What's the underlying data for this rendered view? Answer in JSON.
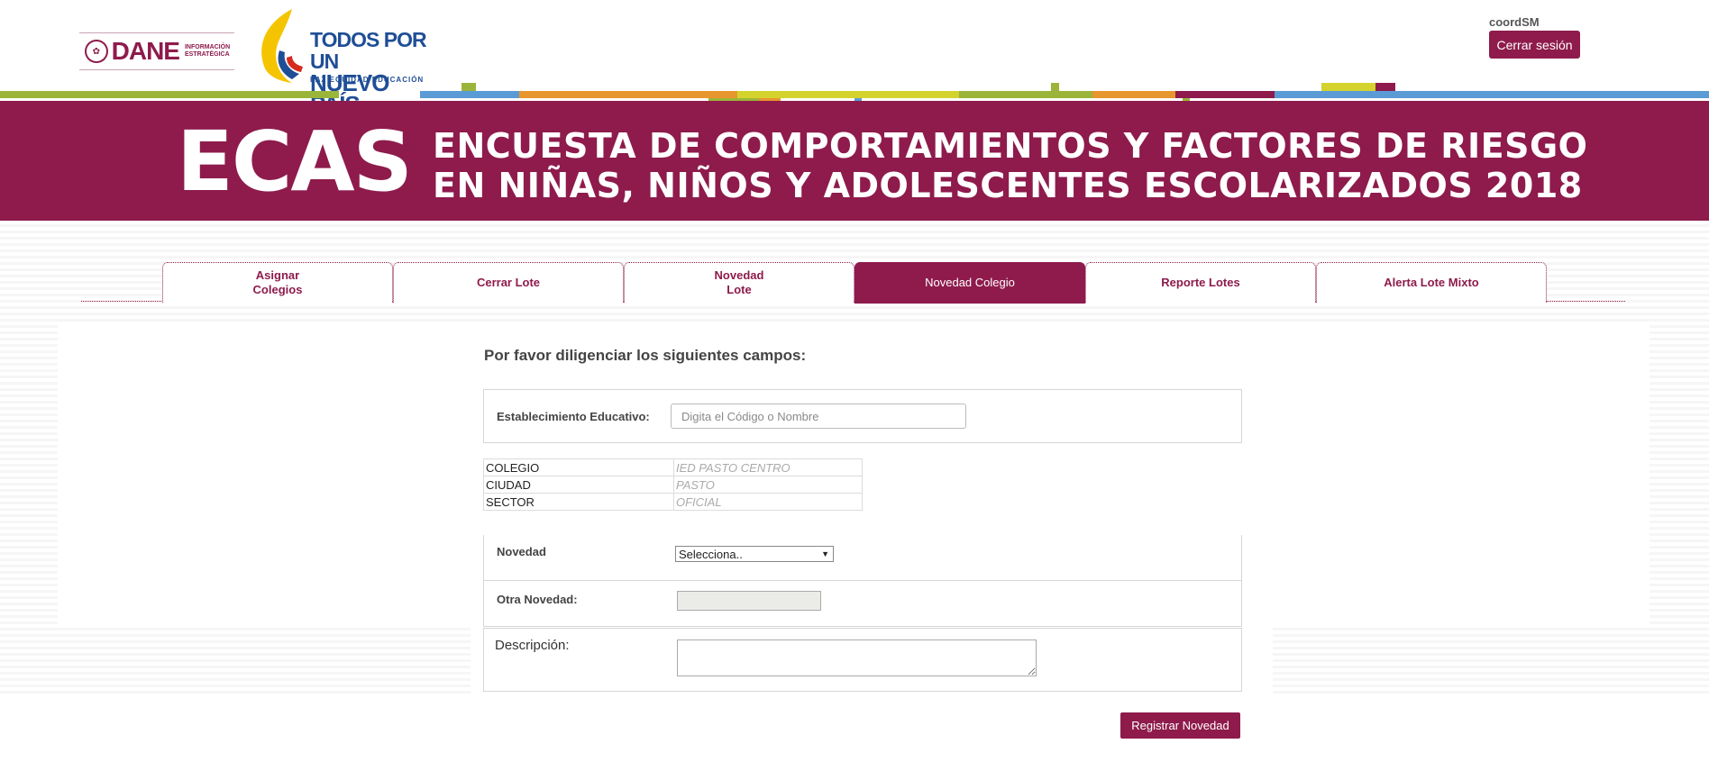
{
  "header": {
    "dane_logo_text": "DANE",
    "dane_logo_sub": "INFORMACIÓN ESTRATÉGICA",
    "campaign_logo_line1": "TODOS POR UN",
    "campaign_logo_line2": "NUEVO PAÍS",
    "campaign_logo_sub": "PAZ  EQUIDAD  EDUCACIÓN",
    "user": "coordSM",
    "logout_label": "Cerrar sesión"
  },
  "banner": {
    "acronym": "ECAS",
    "title": "ENCUESTA DE COMPORTAMIENTOS Y FACTORES DE RIESGO EN NIÑAS, NIÑOS Y ADOLESCENTES ESCOLARIZADOS 2018",
    "color": "#8e1b4c"
  },
  "tabs": [
    {
      "label_line1": "Asignar",
      "label_line2": "Colegios",
      "active": false
    },
    {
      "label_line1": "Cerrar Lote",
      "label_line2": "",
      "active": false
    },
    {
      "label_line1": "Novedad",
      "label_line2": "Lote",
      "active": false
    },
    {
      "label_line1": "Novedad Colegio",
      "label_line2": "",
      "active": true
    },
    {
      "label_line1": "Reporte Lotes",
      "label_line2": "",
      "active": false
    },
    {
      "label_line1": "Alerta Lote Mixto",
      "label_line2": "",
      "active": false
    }
  ],
  "form": {
    "heading": "Por favor diligenciar los siguientes campos:",
    "establishment_label": "Establecimiento Educativo:",
    "establishment_placeholder": "Digita el Código o Nombre",
    "info": [
      {
        "key": "COLEGIO",
        "value": "IED PASTO CENTRO"
      },
      {
        "key": "CIUDAD",
        "value": "PASTO"
      },
      {
        "key": "SECTOR",
        "value": "OFICIAL"
      }
    ],
    "novedad_label": "Novedad",
    "novedad_selected": "Selecciona..",
    "otra_novedad_label": "Otra Novedad:",
    "descripcion_label": "Descripción:",
    "submit_label": "Registrar Novedad"
  }
}
